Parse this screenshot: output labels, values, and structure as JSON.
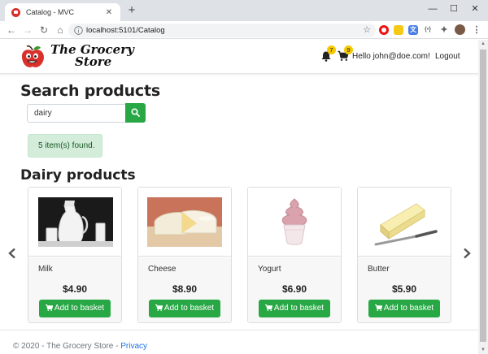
{
  "browser": {
    "tab_title": "Catalog - MVC",
    "tab_close": "✕",
    "new_tab": "+",
    "win_min": "—",
    "win_max": "☐",
    "win_close": "✕",
    "url": "localhost:5101/Catalog",
    "nav_back": "←",
    "nav_forward": "→",
    "nav_reload": "↻",
    "nav_home": "⌂",
    "star": "☆",
    "menu": "⋮"
  },
  "header": {
    "logo_line1": "The Grocery",
    "logo_line2": "Store",
    "notifications_count": "7",
    "basket_count": "9",
    "greeting": "Hello john@doe.com!",
    "logout_label": "Logout"
  },
  "search": {
    "heading": "Search products",
    "value": "dairy",
    "result_message": "5 item(s) found."
  },
  "section": {
    "heading": "Dairy products"
  },
  "products": [
    {
      "name": "Milk",
      "price": "$4.90",
      "button": "Add to basket",
      "image": "milk-jug-and-glass"
    },
    {
      "name": "Cheese",
      "price": "$8.90",
      "button": "Add to basket",
      "image": "brie-cheese-wedge"
    },
    {
      "name": "Yogurt",
      "price": "$6.90",
      "button": "Add to basket",
      "image": "frozen-yogurt-cup"
    },
    {
      "name": "Butter",
      "price": "$5.90",
      "button": "Add to basket",
      "image": "butter-stick-with-knife"
    }
  ],
  "footer": {
    "text": "© 2020 - The Grocery Store - ",
    "privacy_link": "Privacy"
  },
  "colors": {
    "accent_green": "#28a745",
    "badge_yellow": "#f5c800",
    "alert_bg": "#d4edda",
    "link_blue": "#1a73e8"
  }
}
